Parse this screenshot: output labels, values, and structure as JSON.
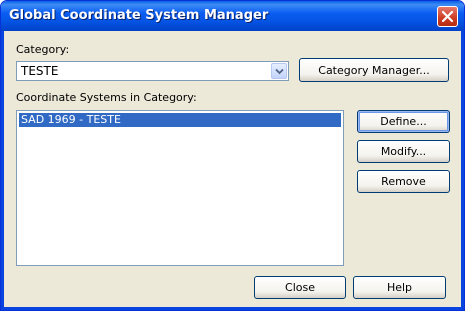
{
  "window": {
    "title": "Global Coordinate System Manager"
  },
  "category": {
    "label": "Category:",
    "selected_value": "TESTE",
    "manager_button": "Category Manager..."
  },
  "coordinate_systems": {
    "label": "Coordinate Systems in Category:",
    "items": [
      "SAD 1969 - TESTE"
    ],
    "selected_index": 0
  },
  "actions": {
    "define": "Define...",
    "modify": "Modify...",
    "remove": "Remove"
  },
  "footer": {
    "close": "Close",
    "help": "Help"
  },
  "colors": {
    "title_bar": "#0553e2",
    "close_button": "#cc3b22",
    "selection": "#316ac5",
    "dialog_background": "#ece9d8"
  },
  "icons": {
    "close": "close-x-icon",
    "dropdown": "chevron-down-icon"
  }
}
